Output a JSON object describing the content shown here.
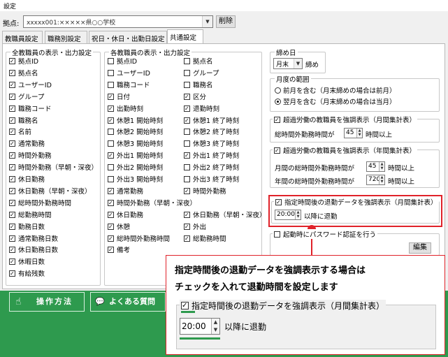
{
  "window": {
    "title": "設定"
  },
  "header": {
    "site_label": "拠点:",
    "site_value": "xxxxx001:×××××県○○学校",
    "delete_button": "削除"
  },
  "tabs": [
    {
      "label": "教職員設定"
    },
    {
      "label": "職務別設定"
    },
    {
      "label": "祝日・休日・出勤日設定"
    },
    {
      "label": "共通設定"
    }
  ],
  "group_all": {
    "title": "全教職員の表示・出力設定",
    "items": [
      {
        "label": "拠点ID",
        "checked": true
      },
      {
        "label": "拠点名",
        "checked": true
      },
      {
        "label": "ユーザーID",
        "checked": true
      },
      {
        "label": "グループ",
        "checked": true
      },
      {
        "label": "職務コード",
        "checked": true
      },
      {
        "label": "職務名",
        "checked": true
      },
      {
        "label": "名前",
        "checked": true
      },
      {
        "label": "通常勤務",
        "checked": true
      },
      {
        "label": "時間外勤務",
        "checked": true
      },
      {
        "label": "時間外勤務（早朝・深夜）",
        "checked": true
      },
      {
        "label": "休日勤務",
        "checked": true
      },
      {
        "label": "休日勤務（早朝・深夜）",
        "checked": true
      },
      {
        "label": "総時間外勤務時間",
        "checked": true
      },
      {
        "label": "総勤務時間",
        "checked": true
      },
      {
        "label": "勤務日数",
        "checked": true
      },
      {
        "label": "通常勤務日数",
        "checked": true
      },
      {
        "label": "休日勤務日数",
        "checked": true
      },
      {
        "label": "休暇日数",
        "checked": true
      },
      {
        "label": "有給残数",
        "checked": true
      }
    ]
  },
  "group_each": {
    "title": "各教職員の表示・出力設定",
    "col1": [
      {
        "label": "拠点ID",
        "checked": false
      },
      {
        "label": "ユーザーID",
        "checked": false
      },
      {
        "label": "職務コード",
        "checked": false
      },
      {
        "label": "日付",
        "checked": true
      },
      {
        "label": "出勤時刻",
        "checked": true
      },
      {
        "label": "休憩1 開始時刻",
        "checked": true
      },
      {
        "label": "休憩2 開始時刻",
        "checked": false
      },
      {
        "label": "休憩3 開始時刻",
        "checked": false
      },
      {
        "label": "外出1 開始時刻",
        "checked": true
      },
      {
        "label": "外出2 開始時刻",
        "checked": false
      },
      {
        "label": "外出3 開始時刻",
        "checked": false
      },
      {
        "label": "通常勤務",
        "checked": true
      },
      {
        "label": "時間外勤務（早朝・深夜）",
        "checked": true
      },
      {
        "label": "休日勤務",
        "checked": true
      },
      {
        "label": "休憩",
        "checked": true
      },
      {
        "label": "総時間外勤務時間",
        "checked": true
      },
      {
        "label": "備考",
        "checked": true
      }
    ],
    "col2": [
      {
        "label": "拠点名",
        "checked": false
      },
      {
        "label": "グループ",
        "checked": false
      },
      {
        "label": "職務名",
        "checked": false
      },
      {
        "label": "区分",
        "checked": true
      },
      {
        "label": "退勤時刻",
        "checked": true
      },
      {
        "label": "休憩1 終了時刻",
        "checked": true
      },
      {
        "label": "休憩2 終了時刻",
        "checked": false
      },
      {
        "label": "休憩3 終了時刻",
        "checked": false
      },
      {
        "label": "外出1 終了時刻",
        "checked": true
      },
      {
        "label": "外出2 終了時刻",
        "checked": false
      },
      {
        "label": "外出3 終了時刻",
        "checked": false
      },
      {
        "label": "時間外勤務",
        "checked": true
      },
      {
        "label": "",
        "checked": false
      },
      {
        "label": "休日勤務（早朝・深夜）",
        "checked": true
      },
      {
        "label": "外出",
        "checked": true
      },
      {
        "label": "総勤務時間",
        "checked": true
      }
    ]
  },
  "closing": {
    "title": "締め日",
    "value": "月末",
    "suffix": "締め"
  },
  "month_range": {
    "title": "月度の範囲",
    "options": [
      {
        "label": "前月を含む（月末締めの場合は前月）",
        "selected": false
      },
      {
        "label": "翌月を含む（月末締めの場合は当月）",
        "selected": true
      }
    ]
  },
  "overtime_month": {
    "title": "超過労働の教職員を強調表示（月間集計表）",
    "checked": true,
    "row_label": "総時間外勤務時間が",
    "value": "45",
    "unit": "時間以上"
  },
  "overtime_year": {
    "title": "超過労働の教職員を強調表示（年間集計表）",
    "checked": true,
    "row1_label": "月間の総時間外勤務時間が",
    "row1_value": "45",
    "row1_unit": "時間以上",
    "row2_label": "年間の総時間外勤務時間が",
    "row2_value": "720",
    "row2_unit": "時間以上"
  },
  "late_leave": {
    "title": "指定時間後の退勤データを強調表示（月間集計表）",
    "checked": true,
    "time": "20:00",
    "suffix": "以降に退勤"
  },
  "password": {
    "title": "起動時にパスワード認証を行う",
    "checked": false,
    "edit_button": "編集"
  },
  "footer": {
    "manual_button": "操作方法",
    "faq_button": "よくある質問"
  },
  "callout": {
    "line1": "指定時間後の退勤データを強調表示する場合は",
    "line2": "チェックを入れて退勤時間を設定します",
    "zoom_title": "指定時間後の退勤データを強調表示（月間集計表）",
    "zoom_time": "20:00",
    "zoom_suffix": "以降に退勤"
  },
  "colors": {
    "accent_red": "#e0222a",
    "footer_green": "#2e9a4e"
  }
}
